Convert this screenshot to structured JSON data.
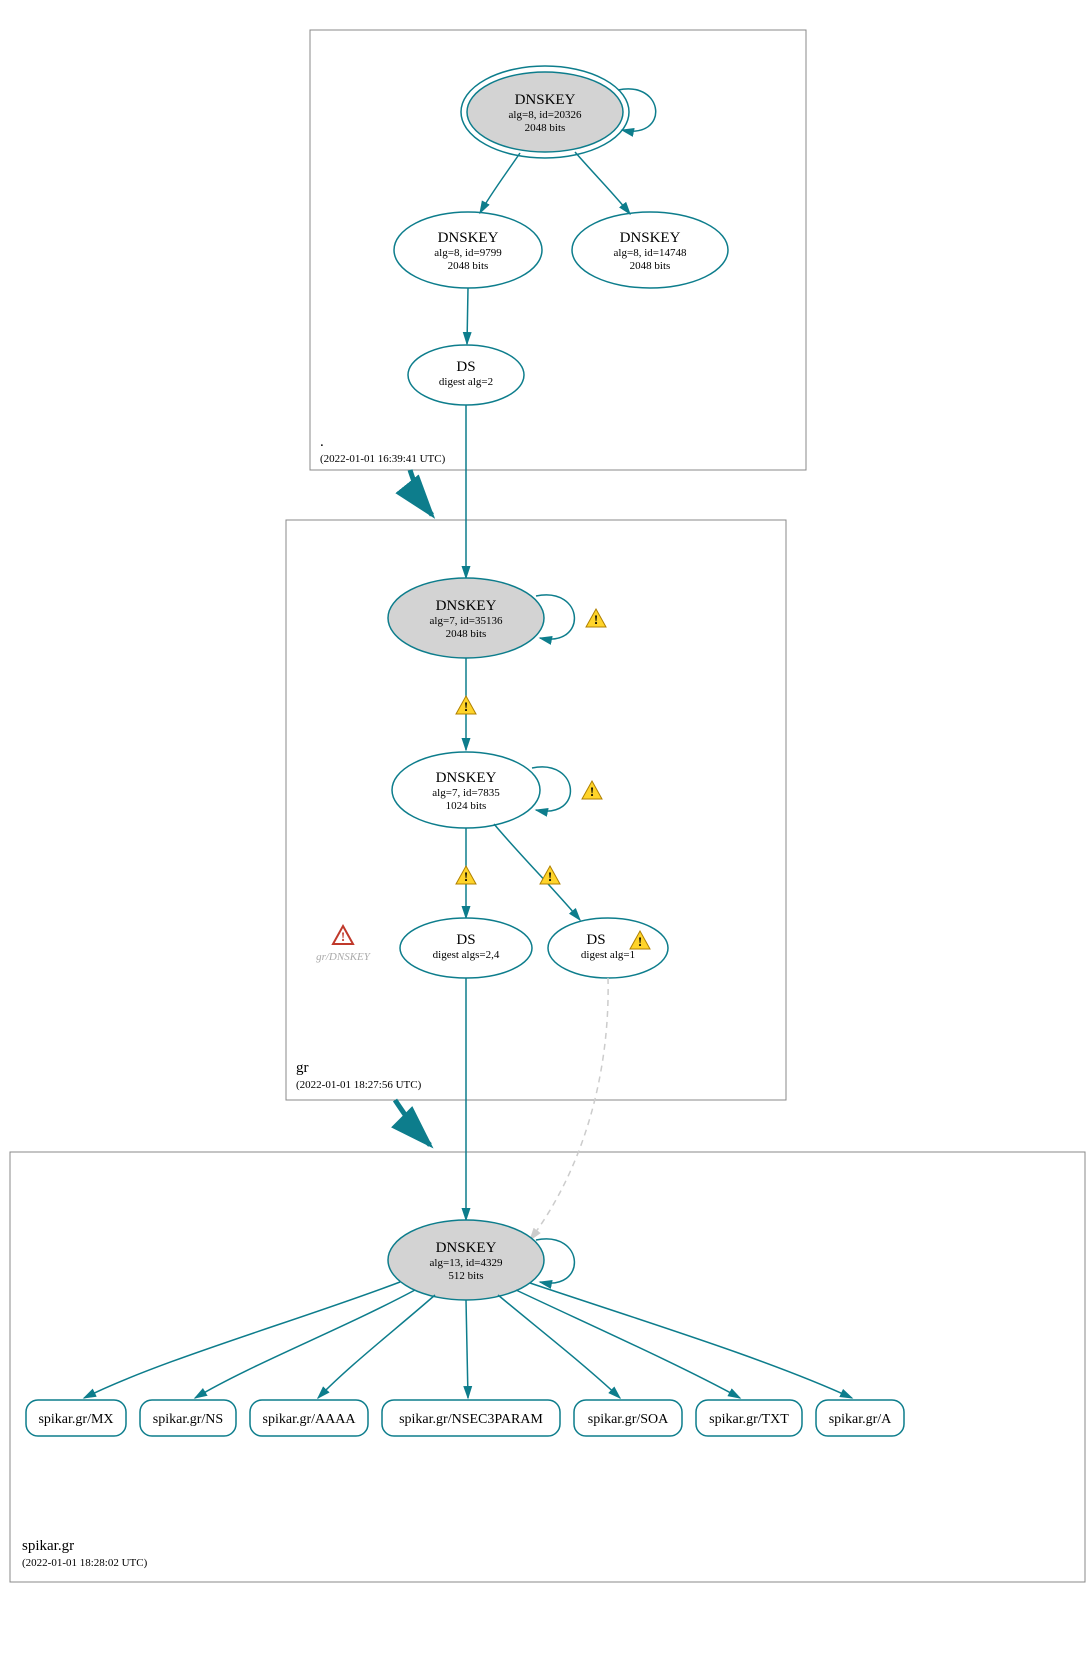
{
  "zones": {
    "root": {
      "label": ".",
      "timestamp": "(2022-01-01 16:39:41 UTC)",
      "nodes": {
        "ksk": {
          "title": "DNSKEY",
          "line2": "alg=8, id=20326",
          "line3": "2048 bits"
        },
        "zsk1": {
          "title": "DNSKEY",
          "line2": "alg=8, id=9799",
          "line3": "2048 bits"
        },
        "zsk2": {
          "title": "DNSKEY",
          "line2": "alg=8, id=14748",
          "line3": "2048 bits"
        },
        "ds": {
          "title": "DS",
          "line2": "digest alg=2"
        }
      }
    },
    "gr": {
      "label": "gr",
      "timestamp": "(2022-01-01 18:27:56 UTC)",
      "side_label": "gr/DNSKEY",
      "nodes": {
        "ksk": {
          "title": "DNSKEY",
          "line2": "alg=7, id=35136",
          "line3": "2048 bits"
        },
        "zsk": {
          "title": "DNSKEY",
          "line2": "alg=7, id=7835",
          "line3": "1024 bits"
        },
        "ds1": {
          "title": "DS",
          "line2": "digest algs=2,4"
        },
        "ds2": {
          "title": "DS",
          "line2": "digest alg=1"
        }
      }
    },
    "spikar": {
      "label": "spikar.gr",
      "timestamp": "(2022-01-01 18:28:02 UTC)",
      "nodes": {
        "ksk": {
          "title": "DNSKEY",
          "line2": "alg=13, id=4329",
          "line3": "512 bits"
        }
      },
      "rrsets": [
        "spikar.gr/MX",
        "spikar.gr/NS",
        "spikar.gr/AAAA",
        "spikar.gr/NSEC3PARAM",
        "spikar.gr/SOA",
        "spikar.gr/TXT",
        "spikar.gr/A"
      ]
    }
  }
}
